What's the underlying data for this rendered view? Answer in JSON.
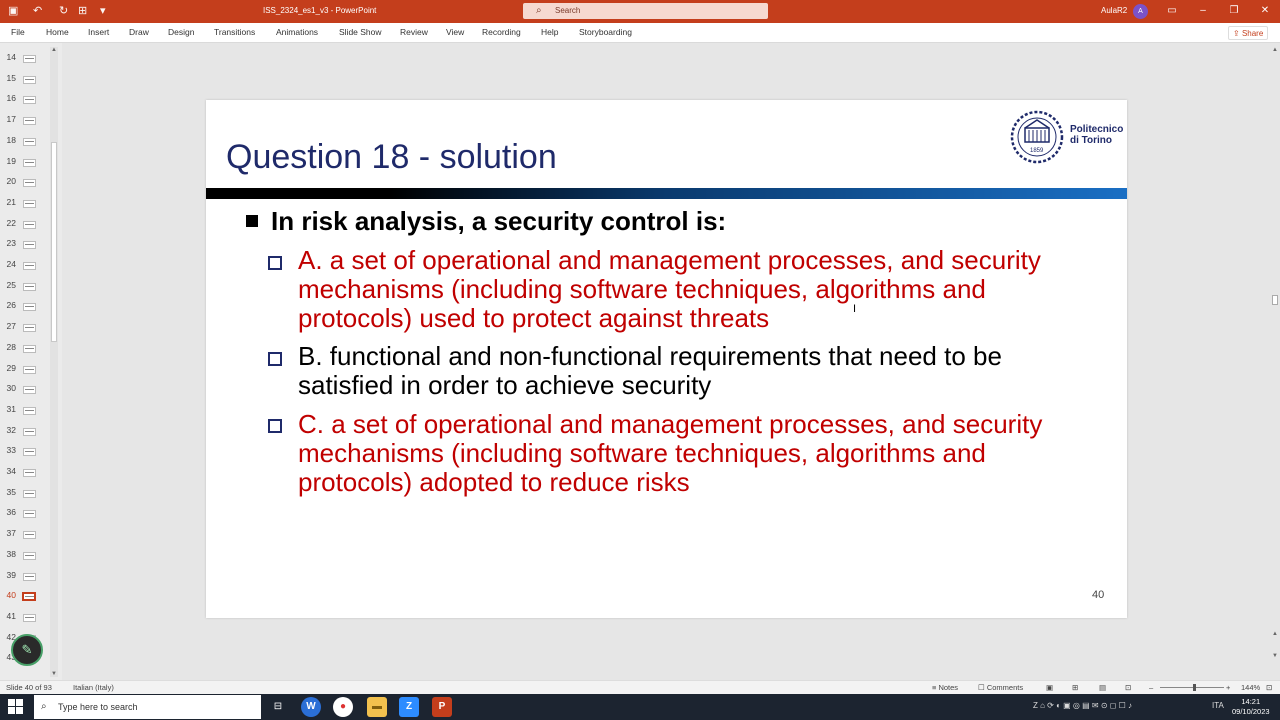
{
  "titlebar": {
    "document_title": "ISS_2324_es1_v3  -  PowerPoint",
    "search_placeholder": "Search",
    "user_name": "AulaR2",
    "user_initial": "A",
    "quick_access": [
      "save-icon",
      "undo-icon",
      "redo-icon",
      "present-icon",
      "customize-icon"
    ]
  },
  "ribbon": {
    "tabs": [
      "File",
      "Home",
      "Insert",
      "Draw",
      "Design",
      "Transitions",
      "Animations",
      "Slide Show",
      "Review",
      "View",
      "Recording",
      "Help",
      "Storyboarding"
    ],
    "share_label": "Share"
  },
  "thumbnails": {
    "slides": [
      "14",
      "15",
      "16",
      "17",
      "18",
      "19",
      "20",
      "21",
      "22",
      "23",
      "24",
      "25",
      "26",
      "27",
      "28",
      "29",
      "30",
      "31",
      "32",
      "33",
      "34",
      "35",
      "36",
      "37",
      "38",
      "39",
      "40",
      "41",
      "42",
      "43"
    ],
    "active": "40"
  },
  "slide": {
    "title": "Question 18 - solution",
    "logo_line1": "Politecnico",
    "logo_line2": "di Torino",
    "logo_year": "1859",
    "question": "In risk analysis, a security control is:",
    "options": [
      {
        "lines": [
          "A. a set of operational and management processes, and security",
          "mechanisms (including software techniques, algorithms and",
          "protocols) used to protect against threats"
        ],
        "correct": true
      },
      {
        "lines": [
          "B. functional and non-functional requirements that need to be",
          "satisfied in order to achieve security"
        ],
        "correct": false
      },
      {
        "lines": [
          "C. a set of operational and management processes, and security",
          "mechanisms (including software techniques, algorithms and",
          "protocols) adopted to reduce risks"
        ],
        "correct": true
      }
    ],
    "page_number": "40",
    "correct_color": "#c00000",
    "title_color": "#1f2a6a"
  },
  "statusbar": {
    "slide_info": "Slide 40 of 93",
    "language": "Italian (Italy)",
    "notes_label": "Notes",
    "comments_label": "Comments",
    "zoom": "144%"
  },
  "taskbar": {
    "search_placeholder": "Type here to search",
    "language": "ITA",
    "time": "14:21",
    "date": "09/10/2023"
  }
}
